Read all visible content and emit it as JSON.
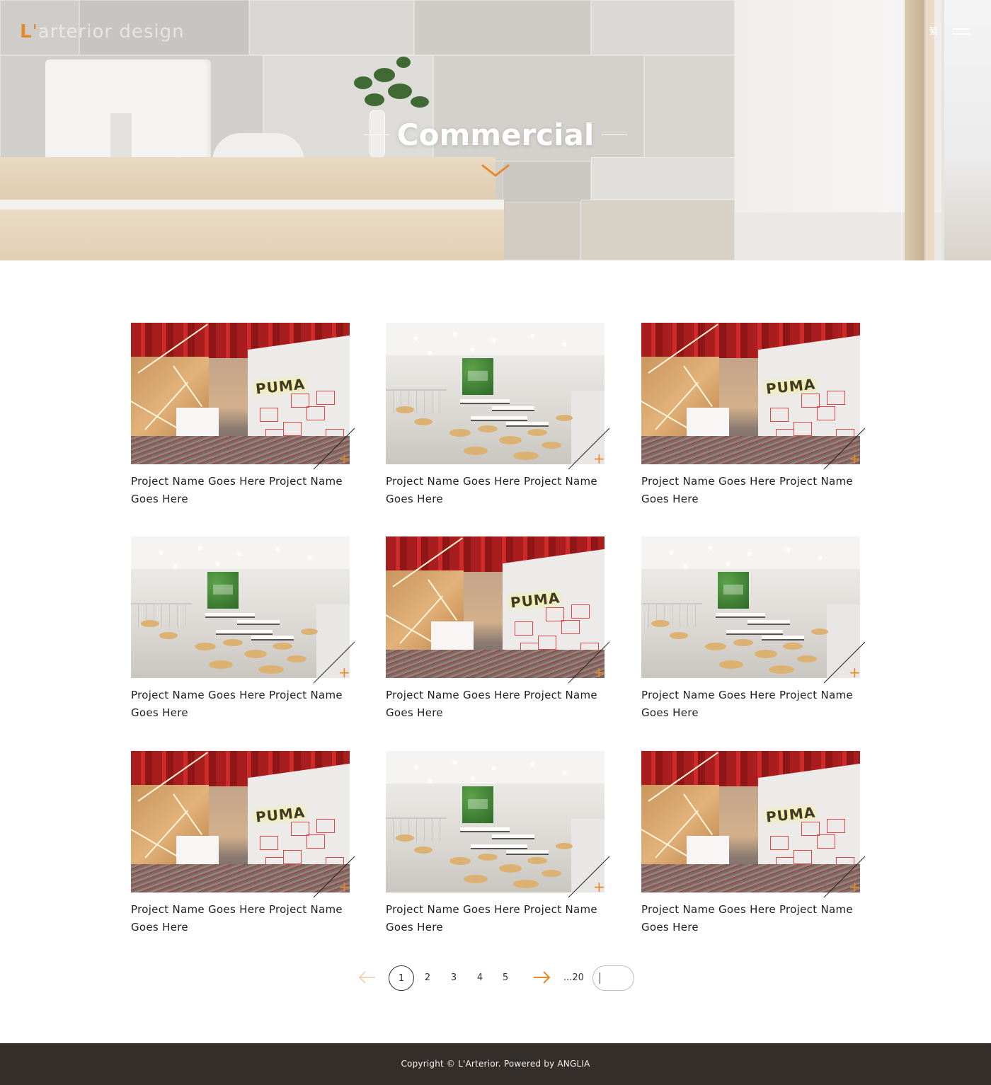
{
  "header": {
    "brand_prefix": "L",
    "brand_apos": "'",
    "brand_rest": "arterior design",
    "lang_label": "繁",
    "menu_icon": "hamburger-menu-icon"
  },
  "hero": {
    "title": "Commercial",
    "scroll_icon": "chevron-down-icon"
  },
  "projects": [
    {
      "title": "Project Name Goes Here Project Name Goes Here",
      "image": "puma-office"
    },
    {
      "title": "Project Name Goes Here Project Name Goes Here",
      "image": "cafe-canteen"
    },
    {
      "title": "Project Name Goes Here Project Name Goes Here",
      "image": "puma-office"
    },
    {
      "title": "Project Name Goes Here Project Name Goes Here",
      "image": "cafe-canteen"
    },
    {
      "title": "Project Name Goes Here Project Name Goes Here",
      "image": "puma-office"
    },
    {
      "title": "Project Name Goes Here Project Name Goes Here",
      "image": "cafe-canteen"
    },
    {
      "title": "Project Name Goes Here Project Name Goes Here",
      "image": "puma-office"
    },
    {
      "title": "Project Name Goes Here Project Name Goes Here",
      "image": "cafe-canteen"
    },
    {
      "title": "Project Name Goes Here Project Name Goes Here",
      "image": "puma-office"
    }
  ],
  "card_plus": "+",
  "pagination": {
    "prev_icon": "arrow-left-icon",
    "next_icon": "arrow-right-icon",
    "pages": [
      "1",
      "2",
      "3",
      "4",
      "5"
    ],
    "current": "1",
    "last": "...20",
    "jump_value": ""
  },
  "footer": {
    "copyright": "Copyright © L'Arterior. Powered by ANGLIA"
  },
  "colors": {
    "accent": "#e58a2c",
    "footer_bg": "#342e2b"
  }
}
